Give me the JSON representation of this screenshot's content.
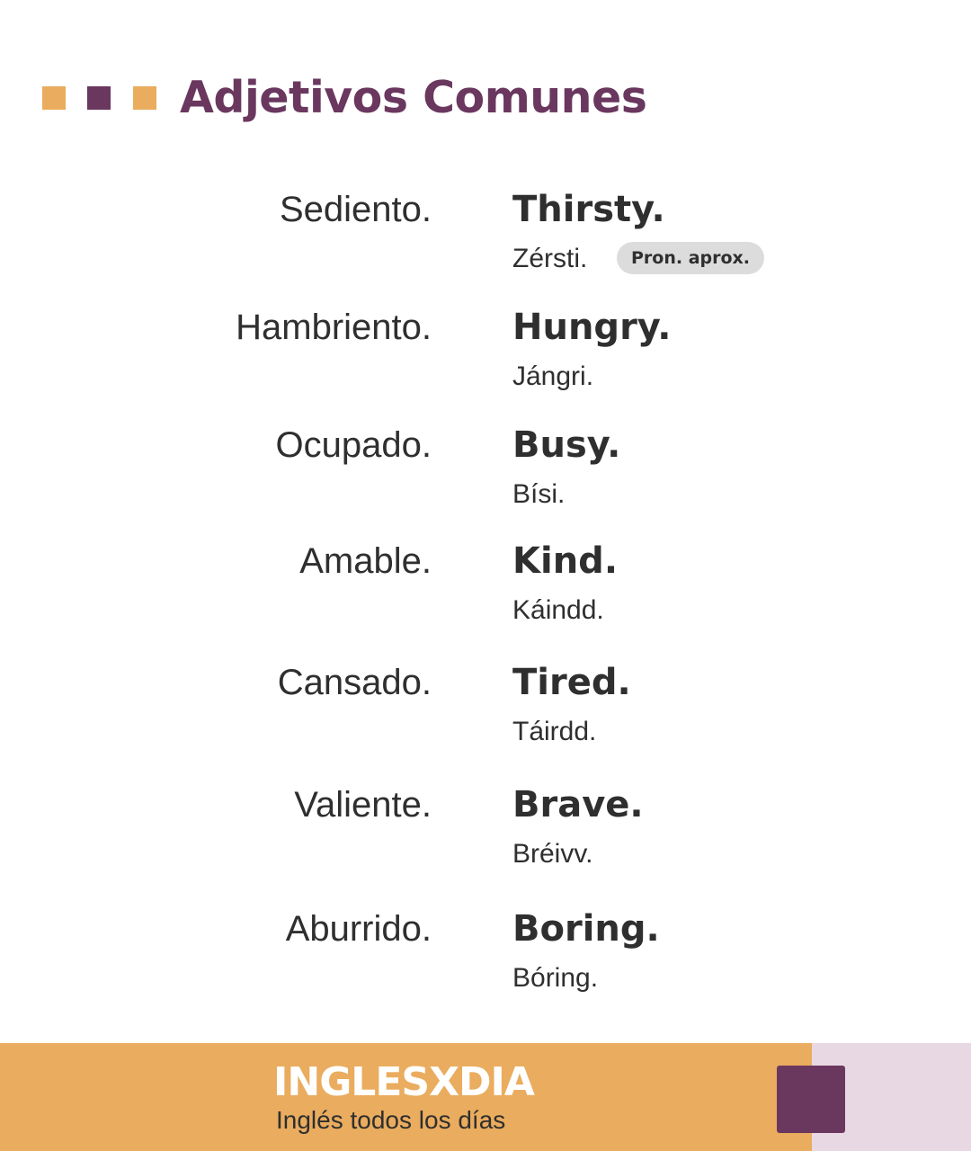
{
  "colors": {
    "accent_orange": "#eaac5e",
    "accent_purple": "#6a375f",
    "footer_side_pink": "#e8d8e3",
    "text_dark": "#2f2f2f",
    "badge_gray": "#dcdcdc"
  },
  "header": {
    "title": "Adjetivos Comunes",
    "decor_squares": [
      "orange",
      "purple",
      "orange"
    ]
  },
  "entries": [
    {
      "es": "Sediento.",
      "en": "Thirsty.",
      "pron": "Zérsti."
    },
    {
      "es": "Hambriento.",
      "en": "Hungry.",
      "pron": "Jángri."
    },
    {
      "es": "Ocupado.",
      "en": "Busy.",
      "pron": "Bísi."
    },
    {
      "es": "Amable.",
      "en": "Kind.",
      "pron": "Káindd."
    },
    {
      "es": "Cansado.",
      "en": "Tired.",
      "pron": "Táirdd."
    },
    {
      "es": "Valiente.",
      "en": "Brave.",
      "pron": "Bréivv."
    },
    {
      "es": "Aburrido.",
      "en": "Boring.",
      "pron": "Bóring."
    }
  ],
  "pron_badge": "Pron. aprox.",
  "footer": {
    "brand": "INGLESXDIA",
    "tagline": "Inglés todos los días"
  }
}
